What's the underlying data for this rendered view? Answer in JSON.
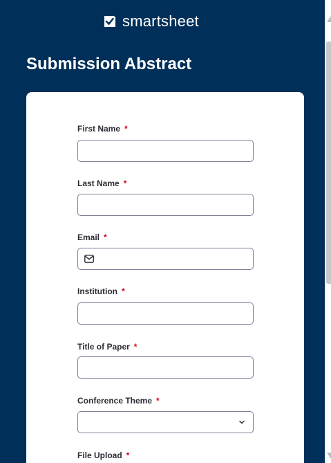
{
  "brand": {
    "name": "smartsheet"
  },
  "form": {
    "title": "Submission Abstract",
    "required_marker": "*",
    "fields": [
      {
        "label": "First Name",
        "type": "text",
        "value": ""
      },
      {
        "label": "Last Name",
        "type": "text",
        "value": ""
      },
      {
        "label": "Email",
        "type": "email",
        "icon": "mail-icon",
        "value": ""
      },
      {
        "label": "Institution",
        "type": "text",
        "value": ""
      },
      {
        "label": "Title of Paper",
        "type": "text",
        "value": ""
      },
      {
        "label": "Conference Theme",
        "type": "select",
        "icon": "chevron-down-icon",
        "value": ""
      },
      {
        "label": "File Upload",
        "type": "file"
      }
    ]
  },
  "colors": {
    "background": "#003059",
    "card": "#ffffff",
    "required": "#d0021b",
    "input_border": "#7f7d96",
    "scroll_thumb": "#c8c8c8"
  }
}
